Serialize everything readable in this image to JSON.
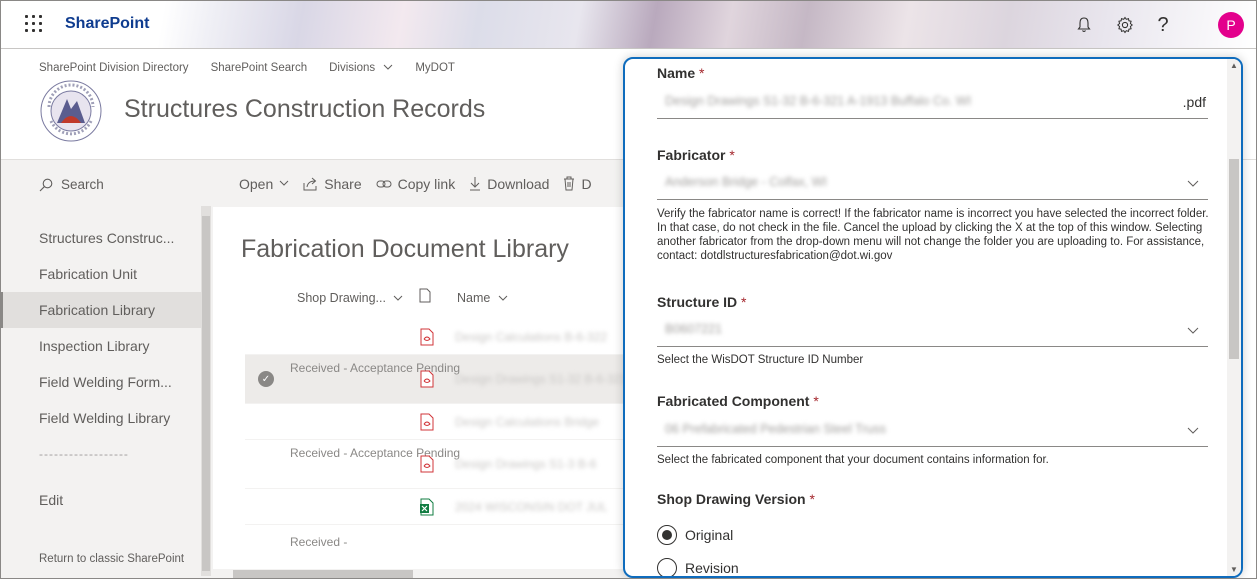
{
  "suitebar": {
    "brand": "SharePoint",
    "avatar_initial": "P"
  },
  "site": {
    "nav": [
      "SharePoint Division Directory",
      "SharePoint Search",
      "Divisions",
      "MyDOT"
    ],
    "title": "Structures Construction Records"
  },
  "left": {
    "search_placeholder": "Search",
    "items": [
      {
        "label": "Structures Construc...",
        "active": false
      },
      {
        "label": "Fabrication Unit",
        "active": false
      },
      {
        "label": "Fabrication Library",
        "active": true
      },
      {
        "label": "Inspection Library",
        "active": false
      },
      {
        "label": "Field Welding Form...",
        "active": false
      },
      {
        "label": "Field Welding Library",
        "active": false
      }
    ],
    "separator": "------------------",
    "edit": "Edit",
    "classic_link": "Return to classic SharePoint"
  },
  "commandbar": {
    "open": "Open",
    "share": "Share",
    "copy_link": "Copy link",
    "download": "Download",
    "delete_stub": "D"
  },
  "library": {
    "title": "Fabrication Document Library",
    "col_shop_drawing": "Shop Drawing...",
    "col_name": "Name",
    "rows": [
      {
        "status": "",
        "name": "Design Calculations B-6-322",
        "type": "pdf",
        "selected": false
      },
      {
        "status": "Received - Acceptance Pending",
        "name": "Design Drawings S1-32 B-6-321",
        "type": "pdf",
        "selected": true
      },
      {
        "status": "",
        "name": "Design Calculations Bridge",
        "type": "pdf",
        "selected": false
      },
      {
        "status": "Received - Acceptance Pending",
        "name": "Design Drawings S1-3 B-6",
        "type": "pdf",
        "selected": false
      },
      {
        "status": "",
        "name": "2024 WISCONSIN DOT JUL",
        "type": "xlsx",
        "selected": false
      },
      {
        "status": "Received -",
        "name": "",
        "type": "",
        "selected": false
      }
    ]
  },
  "panel": {
    "name_label": "Name",
    "name_value": "Design Drawings S1-32 B-6-321 A-1913 Buffalo Co. WI",
    "name_suffix": ".pdf",
    "fabricator_label": "Fabricator",
    "fabricator_value": "Anderson Bridge - Colfax, WI",
    "fabricator_help": "Verify the fabricator name is correct! If the fabricator name is incorrect you have selected the incorrect folder. In that case, do not check in the file. Cancel the upload by clicking the X at the top of this window. Selecting another fabricator from the drop-down menu will not change the folder you are uploading to. For assistance, contact: dotdlstructuresfabrication@dot.wi.gov",
    "structure_label": "Structure ID",
    "structure_value": "B0607221",
    "structure_help": "Select the WisDOT Structure ID Number",
    "component_label": "Fabricated Component",
    "component_value": "06 Prefabricated Pedestrian Steel Truss",
    "component_help": "Select the fabricated component that your document contains information for.",
    "version_label": "Shop Drawing Version",
    "options": [
      {
        "label": "Original",
        "checked": true
      },
      {
        "label": "Revision",
        "checked": false
      }
    ],
    "required_mark": "*"
  },
  "colors": {
    "accent": "#0f6cbd",
    "brand": "#0f3c8f",
    "avatar": "#e3008c",
    "pdf": "#d13438",
    "xlsx": "#107c41"
  }
}
